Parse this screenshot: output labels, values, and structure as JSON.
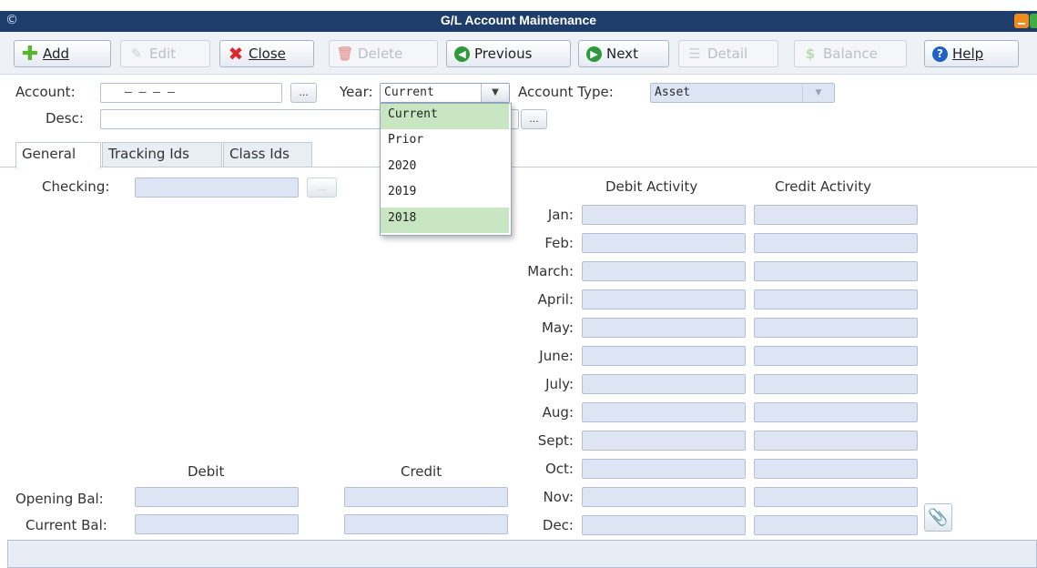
{
  "window": {
    "title": "G/L Account Maintenance",
    "logo_glyph": "©"
  },
  "toolbar": {
    "add": "Add",
    "edit": "Edit",
    "close": "Close",
    "delete": "Delete",
    "previous": "Previous",
    "next": "Next",
    "detail": "Detail",
    "balance": "Balance",
    "help": "Help"
  },
  "form": {
    "account_label": "Account:",
    "account_value": "–   –   –   –",
    "year_label": "Year:",
    "year_value": "Current",
    "account_type_label": "Account Type:",
    "account_type_value": "Asset",
    "desc_label": "Desc:",
    "dots": "..."
  },
  "year_dropdown": {
    "options": [
      "Current",
      "Prior",
      "2020",
      "2019",
      "2018"
    ],
    "selected": "Current",
    "hovered": "2018"
  },
  "tabs": [
    "General",
    "Tracking Ids",
    "Class Ids"
  ],
  "general": {
    "checking_label": "Checking:",
    "debit_activity": "Debit Activity",
    "credit_activity": "Credit Activity",
    "months": [
      "Jan:",
      "Feb:",
      "March:",
      "April:",
      "May:",
      "June:",
      "July:",
      "Aug:",
      "Sept:",
      "Oct:",
      "Nov:",
      "Dec:"
    ],
    "debit_header": "Debit",
    "credit_header": "Credit",
    "opening_bal": "Opening Bal:",
    "current_bal": "Current Bal:"
  },
  "colors": {
    "titlebar": "#1e3d6b",
    "field_fill": "#dde4f4",
    "dropdown_highlight": "#c8e6c1"
  },
  "icons": [
    "add-icon",
    "edit-icon",
    "close-icon",
    "delete-icon",
    "previous-icon",
    "next-icon",
    "detail-icon",
    "balance-icon",
    "help-icon",
    "paperclip-icon",
    "chevron-down-icon"
  ]
}
